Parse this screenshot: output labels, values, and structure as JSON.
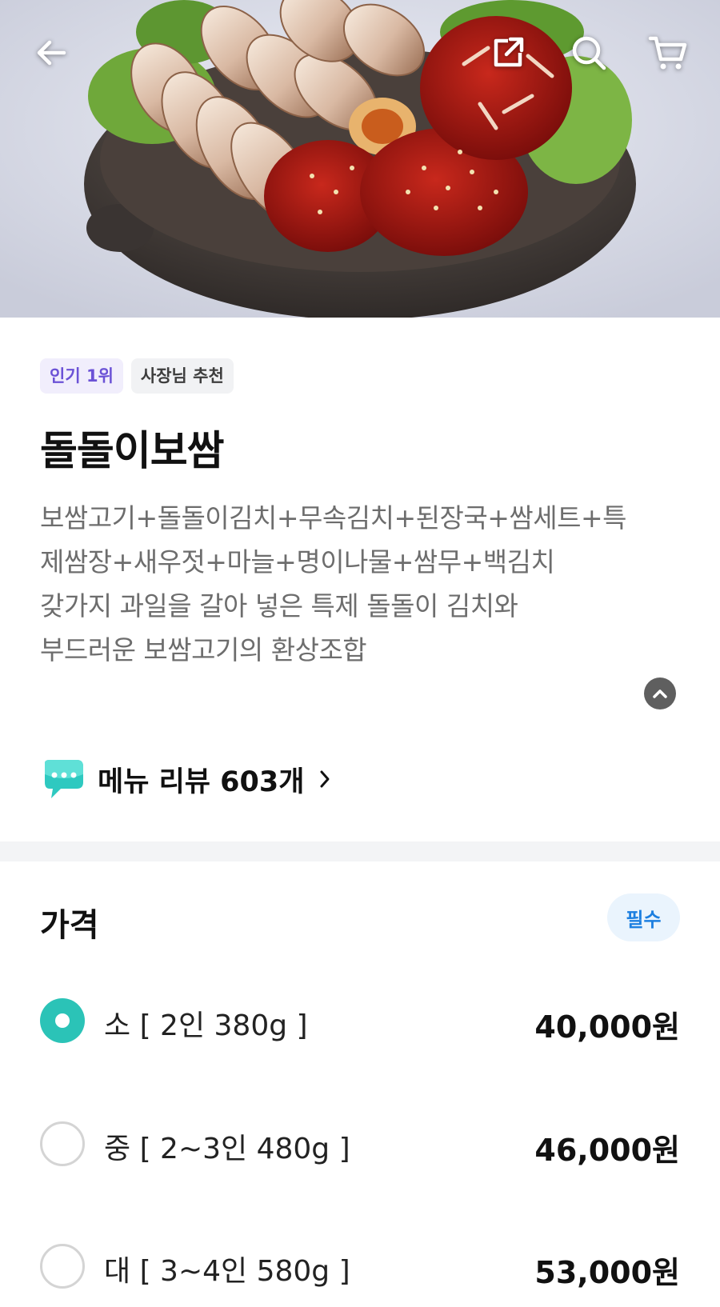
{
  "header": {
    "back_icon": "arrow-left-icon",
    "share_icon": "share-icon",
    "search_icon": "search-icon",
    "cart_icon": "cart-icon"
  },
  "hero_image": {
    "subject": "bossam platter with pork slices and red kimchi in clay bowl"
  },
  "badges": [
    {
      "label": "인기 1위",
      "color": "#6b52d6"
    },
    {
      "label": "사장님 추천",
      "color": "#3d3d3d"
    }
  ],
  "menu": {
    "title": "돌돌이보쌈",
    "description_lines": [
      "보쌈고기+돌돌이김치+무속김치+된장국+쌈세트+특",
      "제쌈장+새우젓+마늘+명이나물+쌈무+백김치",
      "갖가지 과일을 갈아 넣은 특제 돌돌이 김치와",
      "부드러운 보쌈고기의 환상조합"
    ],
    "collapse_icon": "chevron-up-icon"
  },
  "review": {
    "icon": "speech-bubble-icon",
    "label": "메뉴 리뷰 603개",
    "chevron": "chevron-right-icon"
  },
  "price_section": {
    "title": "가격",
    "required_label": "필수",
    "accent_color": "#2bc3b7",
    "options": [
      {
        "label": "소 [ 2인 380g ]",
        "price": "40,000원",
        "selected": true
      },
      {
        "label": "중 [ 2~3인 480g ]",
        "price": "46,000원",
        "selected": false
      },
      {
        "label": "대 [ 3~4인 580g ]",
        "price": "53,000원",
        "selected": false
      }
    ]
  }
}
